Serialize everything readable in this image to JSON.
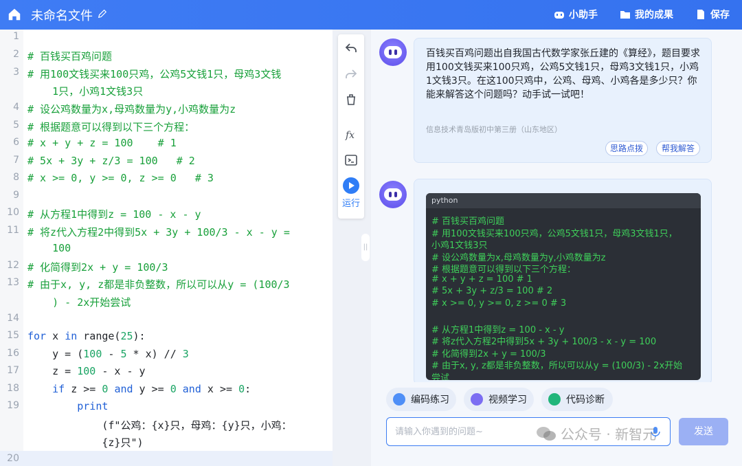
{
  "header": {
    "title": "未命名文件",
    "assistant": "小助手",
    "results": "我的成果",
    "save": "保存"
  },
  "editor": {
    "lines": [
      {
        "n": "1",
        "text": ""
      },
      {
        "n": "2",
        "text": "# 百钱买百鸡问题"
      },
      {
        "n": "3",
        "text": "# 用100文钱买来100只鸡，公鸡5文钱1只，母鸡3文钱"
      },
      {
        "n": "",
        "text": "    1只，小鸡1文钱3只"
      },
      {
        "n": "4",
        "text": "# 设公鸡数量为x,母鸡数量为y,小鸡数量为z"
      },
      {
        "n": "5",
        "text": "# 根据题意可以得到以下三个方程："
      },
      {
        "n": "6",
        "text": "# x + y + z = 100    # 1"
      },
      {
        "n": "7",
        "text": "# 5x + 3y + z/3 = 100   # 2"
      },
      {
        "n": "8",
        "text": "# x >= 0, y >= 0, z >= 0   # 3"
      },
      {
        "n": "9",
        "text": ""
      },
      {
        "n": "10",
        "text": "# 从方程1中得到z = 100 - x - y"
      },
      {
        "n": "11",
        "text": "# 将z代入方程2中得到5x + 3y + 100/3 - x - y ="
      },
      {
        "n": "",
        "text": "    100"
      },
      {
        "n": "12",
        "text": "# 化简得到2x + y = 100/3"
      },
      {
        "n": "13",
        "text": "# 由于x, y, z都是非负整数，所以可以从y = (100/3"
      },
      {
        "n": "",
        "text": "    ) - 2x开始尝试"
      },
      {
        "n": "14",
        "text": ""
      },
      {
        "n": "15",
        "text": "for x in range(25):"
      },
      {
        "n": "16",
        "text": "    y = (100 - 5 * x) // 3"
      },
      {
        "n": "17",
        "text": "    z = 100 - x - y"
      },
      {
        "n": "18",
        "text": "    if z >= 0 and y >= 0 and x >= 0:"
      },
      {
        "n": "19",
        "text": "        print"
      },
      {
        "n": "",
        "text": "            (f\"公鸡：{x}只，母鸡：{y}只，小鸡："
      },
      {
        "n": "",
        "text": "            {z}只\")"
      },
      {
        "n": "20",
        "text": ""
      }
    ]
  },
  "toolbar": {
    "run": "运行"
  },
  "chat": {
    "question": "百钱买百鸡问题出自我国古代数学家张丘建的《算经》，题目要求用100文钱买来100只鸡，公鸡5文钱1只，母鸡3文钱1只，小鸡1文钱3只。在这100只鸡中，公鸡、母鸡、小鸡各是多少只？你能来解答这个问题吗？动手试一试吧！",
    "source": "信息技术青岛版初中第三册（山东地区）",
    "hint_button": "思路点拨",
    "help_button": "帮我解答",
    "code_lang": "python",
    "code_lines": [
      "# 百钱买百鸡问题",
      "# 用100文钱买来100只鸡，公鸡5文钱1只，母鸡3文钱1只，",
      "小鸡1文钱3只",
      "# 设公鸡数量为x,母鸡数量为y,小鸡数量为z",
      "# 根据题意可以得到以下三个方程：",
      "# x + y + z = 100    # 1",
      "# 5x + 3y + z/3 = 100    # 2",
      "# x >= 0, y >= 0, z >= 0    # 3",
      "",
      "# 从方程1中得到z = 100 - x - y",
      "# 将z代入方程2中得到5x + 3y + 100/3 - x - y = 100",
      "# 化简得到2x + y = 100/3",
      "# 由于x, y, z都是非负整数，所以可以从y = (100/3) - 2x开始",
      "尝试"
    ]
  },
  "bottom": {
    "chip1": "编码练习",
    "chip2": "视频学习",
    "chip3": "代码诊断",
    "placeholder": "请输入你遇到的问题~",
    "send": "发送"
  },
  "watermark": "公众号 · 新智元",
  "colors": {
    "header": "#3a78f2",
    "comment": "#18a03a",
    "keyword": "#1f5fd6",
    "number": "#19a463",
    "run": "#2f7df6"
  }
}
